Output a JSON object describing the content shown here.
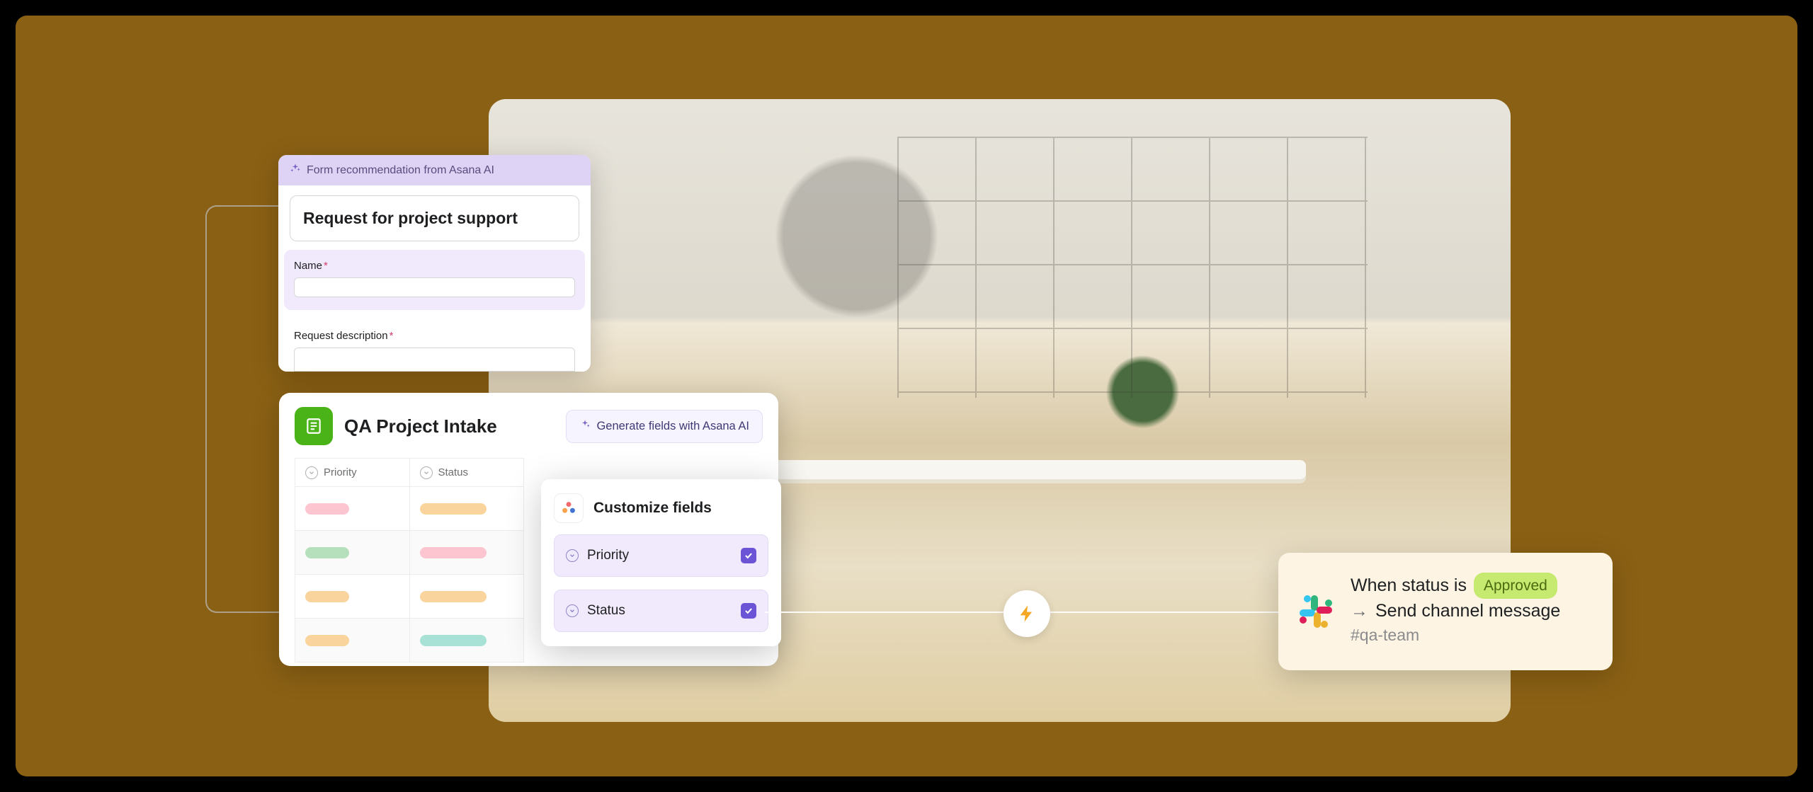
{
  "form_card": {
    "rec_label": "Form recommendation from Asana AI",
    "title": "Request for project support",
    "field_name_label": "Name",
    "field_desc_label": "Request description"
  },
  "intake": {
    "title": "QA Project Intake",
    "ai_button": "Generate fields with Asana AI",
    "columns": {
      "priority": "Priority",
      "status": "Status"
    }
  },
  "customize": {
    "title": "Customize fields",
    "option_priority": "Priority",
    "option_status": "Status"
  },
  "automation": {
    "when_prefix": "When status is",
    "status_value": "Approved",
    "action_label": "Send channel message",
    "channel": "#qa-team"
  }
}
